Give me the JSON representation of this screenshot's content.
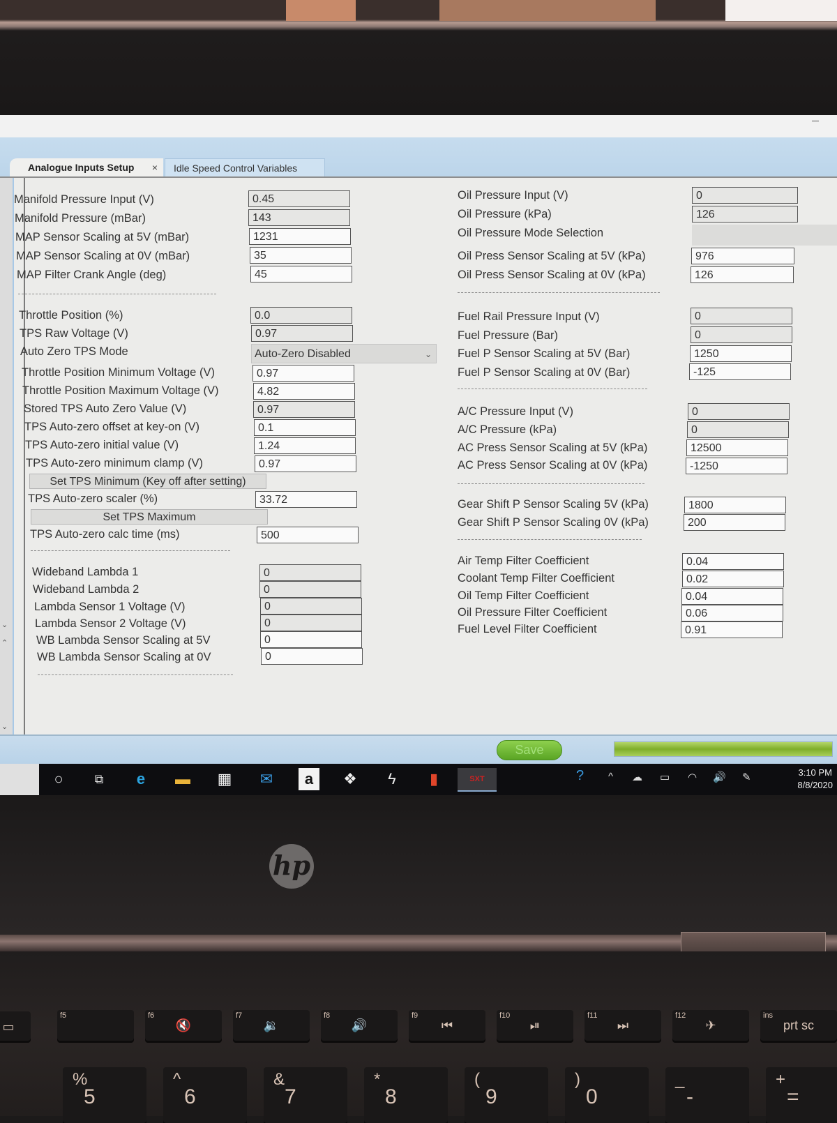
{
  "window": {
    "tabs": [
      {
        "label": "Analogue Inputs Setup",
        "active": true,
        "close_glyph": "×"
      },
      {
        "label": "Idle Speed Control Variables",
        "active": false
      }
    ]
  },
  "map_section": [
    {
      "label": "Manifold Pressure Input (V)",
      "value": "0.45",
      "readonly": true
    },
    {
      "label": "Manifold Pressure (mBar)",
      "value": "143",
      "readonly": true
    },
    {
      "label": "MAP Sensor Scaling at 5V (mBar)",
      "value": "1231",
      "readonly": false
    },
    {
      "label": "MAP Sensor Scaling at 0V (mBar)",
      "value": "35",
      "readonly": false
    },
    {
      "label": "MAP Filter Crank Angle (deg)",
      "value": "45",
      "readonly": false
    }
  ],
  "tps_section": {
    "throttle_position": {
      "label": "Throttle Position (%)",
      "value": "0.0"
    },
    "tps_raw_voltage": {
      "label": "TPS Raw Voltage (V)",
      "value": "0.97"
    },
    "auto_zero_mode": {
      "label": "Auto Zero TPS Mode",
      "selected": "Auto-Zero Disabled"
    },
    "min_voltage": {
      "label": "Throttle Position Minimum Voltage (V)",
      "value": "0.97"
    },
    "max_voltage": {
      "label": "Throttle Position Maximum Voltage (V)",
      "value": "4.82"
    },
    "stored_auto_zero": {
      "label": "Stored TPS Auto Zero Value (V)",
      "value": "0.97"
    },
    "offset_key_on": {
      "label": "TPS Auto-zero offset at key-on (V)",
      "value": "0.1"
    },
    "initial_value": {
      "label": "TPS Auto-zero initial value (V)",
      "value": "1.24"
    },
    "min_clamp": {
      "label": "TPS Auto-zero minimum clamp (V)",
      "value": "0.97"
    },
    "set_min_button": "Set TPS Minimum (Key off after setting)",
    "scaler": {
      "label": "TPS Auto-zero scaler (%)",
      "value": "33.72"
    },
    "set_max_button": "Set TPS Maximum",
    "calc_time": {
      "label": "TPS Auto-zero calc time (ms)",
      "value": "500"
    }
  },
  "lambda_section": [
    {
      "label": "Wideband Lambda 1",
      "value": "0"
    },
    {
      "label": "Wideband Lambda 2",
      "value": "0"
    },
    {
      "label": "Lambda Sensor 1 Voltage (V)",
      "value": "0"
    },
    {
      "label": "Lambda Sensor 2 Voltage (V)",
      "value": "0"
    },
    {
      "label": "WB Lambda Sensor Scaling at 5V",
      "value": "0"
    },
    {
      "label": "WB Lambda Sensor Scaling at 0V",
      "value": "0"
    }
  ],
  "oil_section": {
    "input": {
      "label": "Oil Pressure Input (V)",
      "value": "0"
    },
    "pressure": {
      "label": "Oil Pressure (kPa)",
      "value": "126"
    },
    "mode": {
      "label": "Oil Pressure Mode Selection",
      "value": ""
    },
    "scale5": {
      "label": "Oil Press Sensor Scaling at 5V (kPa)",
      "value": "976"
    },
    "scale0": {
      "label": "Oil Press Sensor Scaling at 0V (kPa)",
      "value": "126"
    }
  },
  "fuel_section": [
    {
      "label": "Fuel Rail Pressure Input (V)",
      "value": "0",
      "readonly": true
    },
    {
      "label": "Fuel Pressure (Bar)",
      "value": "0",
      "readonly": true
    },
    {
      "label": "Fuel P Sensor Scaling at 5V (Bar)",
      "value": "1250",
      "readonly": false
    },
    {
      "label": "Fuel P Sensor Scaling at 0V (Bar)",
      "value": "-125",
      "readonly": false
    }
  ],
  "ac_section": [
    {
      "label": "A/C Pressure Input (V)",
      "value": "0",
      "readonly": true
    },
    {
      "label": "A/C Pressure (kPa)",
      "value": "0",
      "readonly": true
    },
    {
      "label": "AC Press Sensor Scaling at 5V (kPa)",
      "value": "12500",
      "readonly": false
    },
    {
      "label": "AC Press Sensor Scaling at 0V (kPa)",
      "value": "-1250",
      "readonly": false
    }
  ],
  "gear_section": [
    {
      "label": "Gear Shift P Sensor Scaling 5V (kPa)",
      "value": "1800"
    },
    {
      "label": "Gear Shift P Sensor Scaling 0V (kPa)",
      "value": "200"
    }
  ],
  "filter_section": [
    {
      "label": "Air Temp Filter Coefficient",
      "value": "0.04"
    },
    {
      "label": "Coolant Temp Filter Coefficient",
      "value": "0.02"
    },
    {
      "label": "Oil Temp Filter Coefficient",
      "value": "0.04"
    },
    {
      "label": "Oil Pressure Filter Coefficient",
      "value": "0.06"
    },
    {
      "label": "Fuel Level Filter Coefficient",
      "value": "0.91"
    }
  ],
  "statusbar": {
    "save_label": "Save",
    "progress_fraction": 1.0
  },
  "taskbar": {
    "apps": [
      {
        "name": "cortana-search",
        "glyph": "○"
      },
      {
        "name": "task-view",
        "glyph": "⧉"
      },
      {
        "name": "edge",
        "glyph": "e"
      },
      {
        "name": "file-explorer",
        "glyph": "▬"
      },
      {
        "name": "store",
        "glyph": "▦"
      },
      {
        "name": "mail",
        "glyph": "✉"
      },
      {
        "name": "amazon",
        "glyph": "a"
      },
      {
        "name": "dropbox",
        "glyph": "❖"
      },
      {
        "name": "app-bolt",
        "glyph": "ϟ"
      },
      {
        "name": "office",
        "glyph": "▮"
      },
      {
        "name": "sxt",
        "glyph": "SXT"
      }
    ],
    "clock_time": "3:10 PM",
    "clock_date": "8/8/2020"
  },
  "keyboard": {
    "fn_keys": [
      {
        "fn": "f5",
        "glyph": ""
      },
      {
        "fn": "f6",
        "glyph": "🔇"
      },
      {
        "fn": "f7",
        "glyph": "🔉"
      },
      {
        "fn": "f8",
        "glyph": "🔊"
      },
      {
        "fn": "f9",
        "glyph": "⏮"
      },
      {
        "fn": "f10",
        "glyph": "⏯"
      },
      {
        "fn": "f11",
        "glyph": "⏭"
      },
      {
        "fn": "f12",
        "glyph": "✈"
      },
      {
        "fn": "ins",
        "glyph": "prt sc"
      }
    ],
    "num_keys": [
      {
        "top": "%",
        "bottom": "5"
      },
      {
        "top": "^",
        "bottom": "6"
      },
      {
        "top": "&",
        "bottom": "7"
      },
      {
        "top": "*",
        "bottom": "8"
      },
      {
        "top": "(",
        "bottom": "9"
      },
      {
        "top": ")",
        "bottom": "0"
      },
      {
        "top": "_",
        "bottom": "-"
      },
      {
        "top": "+",
        "bottom": "="
      }
    ],
    "brand": "hp"
  },
  "colors": {
    "ribbon": "#c6dcee",
    "save_green": "#6fba35",
    "progress_green": "#8fbe3a"
  }
}
